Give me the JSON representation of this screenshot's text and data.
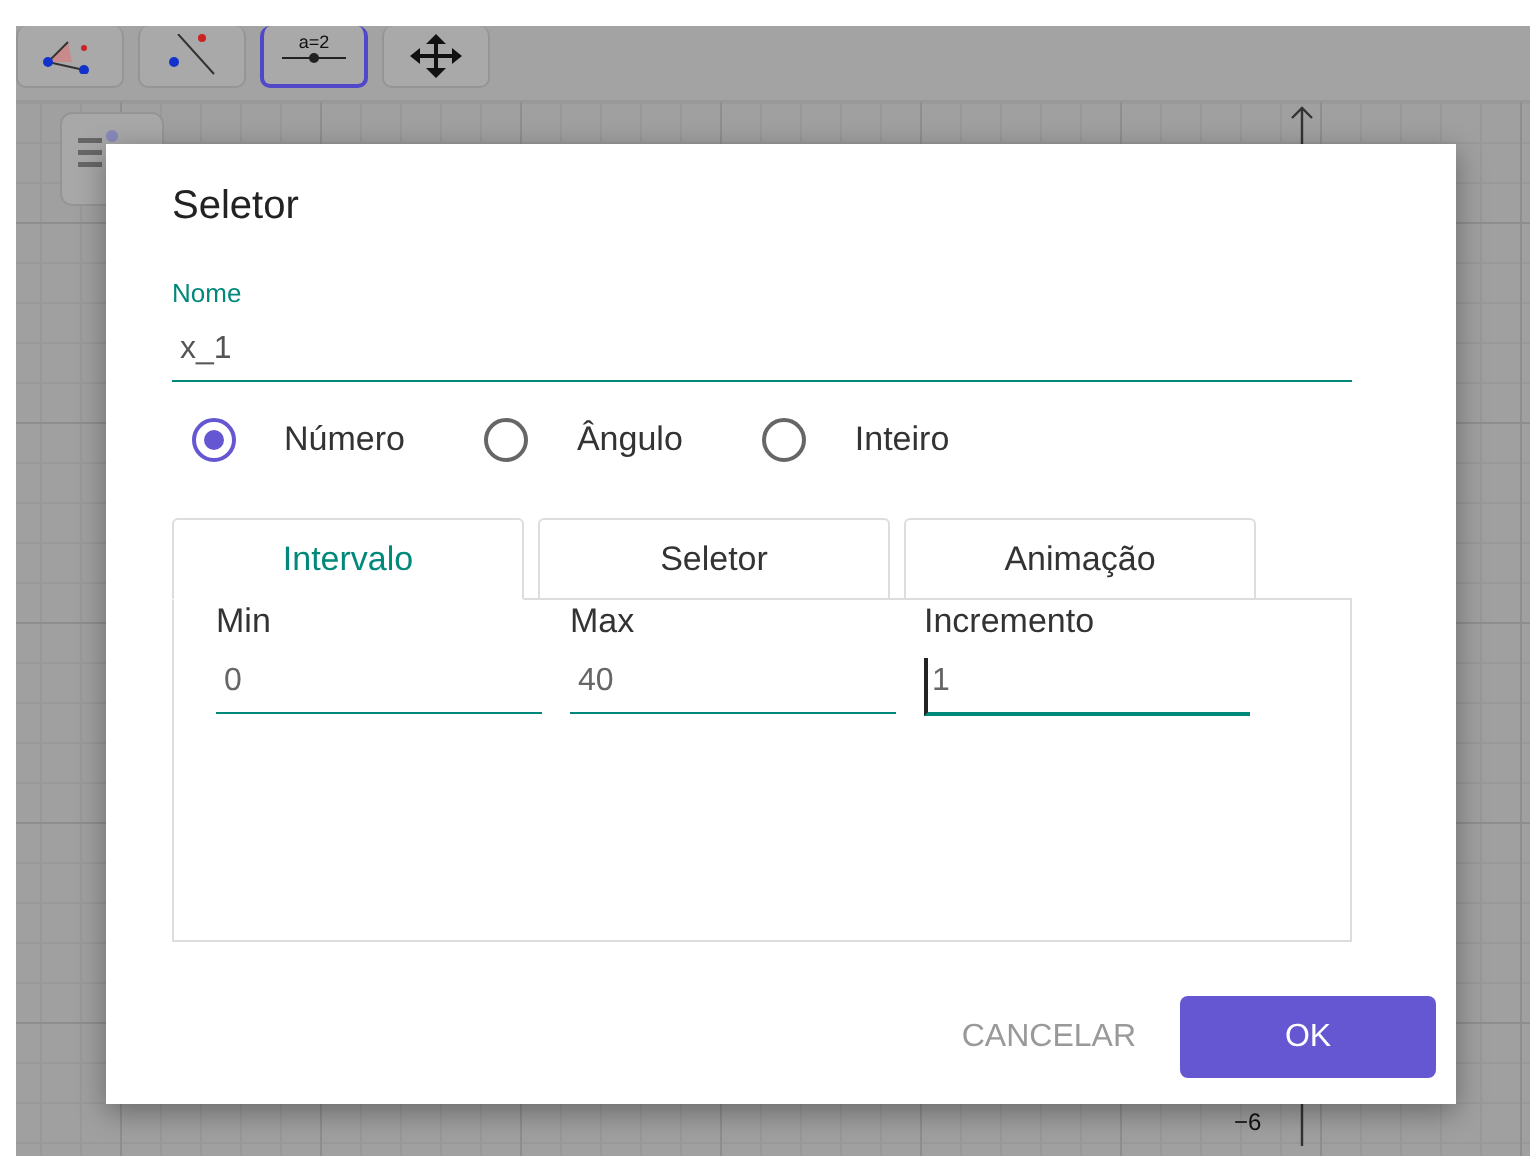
{
  "toolbar": {
    "tools": [
      {
        "kind": "angle",
        "selected": false
      },
      {
        "kind": "line",
        "selected": false
      },
      {
        "kind": "slider",
        "label": "a=2",
        "selected": true
      },
      {
        "kind": "move",
        "selected": false
      }
    ]
  },
  "graphics": {
    "axis_label": "−6"
  },
  "dialog": {
    "title": "Seletor",
    "name_field": {
      "label": "Nome",
      "value": "x_1"
    },
    "types": [
      {
        "label": "Número",
        "selected": true
      },
      {
        "label": "Ângulo",
        "selected": false
      },
      {
        "label": "Inteiro",
        "selected": false
      }
    ],
    "tabs": [
      {
        "label": "Intervalo",
        "selected": true
      },
      {
        "label": "Seletor",
        "selected": false
      },
      {
        "label": "Animação",
        "selected": false
      }
    ],
    "fields": [
      {
        "label": "Min",
        "value": "0",
        "focused": false
      },
      {
        "label": "Max",
        "value": "40",
        "focused": false
      },
      {
        "label": "Incremento",
        "value": "1",
        "focused": true
      }
    ],
    "buttons": [
      {
        "kind": "text",
        "label": "CANCELAR"
      },
      {
        "kind": "primary",
        "label": "OK"
      }
    ]
  }
}
